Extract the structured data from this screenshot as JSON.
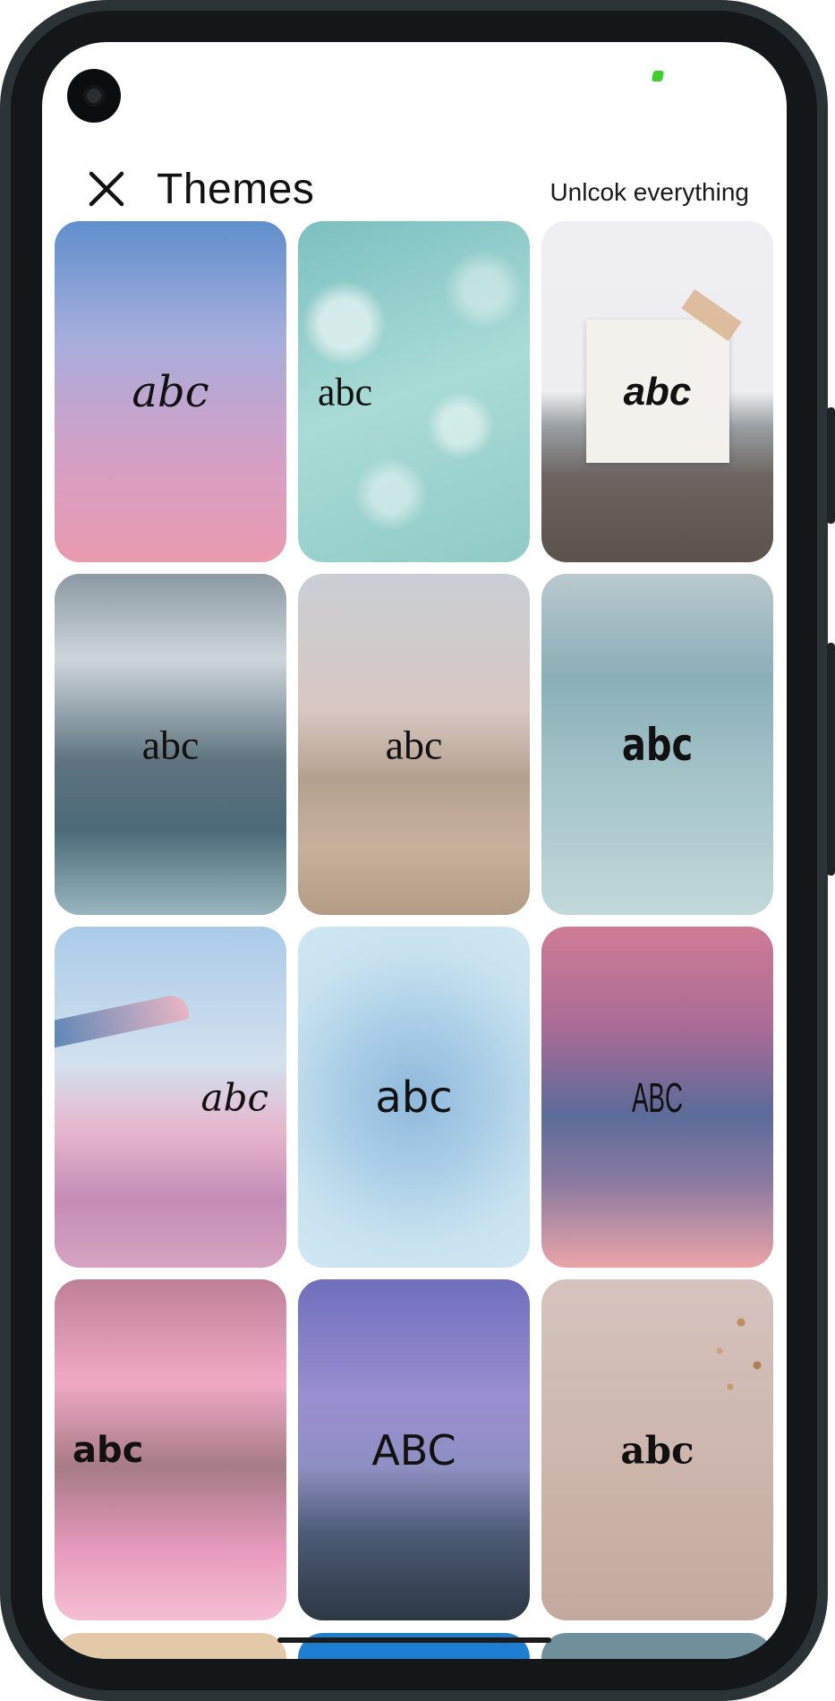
{
  "header": {
    "title": "Themes",
    "unlock_label": "Unlcok everything"
  },
  "themes": [
    {
      "sample": "abc",
      "style": "script",
      "background": "blue-pink gradient"
    },
    {
      "sample": "abc",
      "style": "serif-light",
      "background": "water"
    },
    {
      "sample": "abc",
      "style": "bold-italic",
      "background": "beach photo frame"
    },
    {
      "sample": "abc",
      "style": "mono-serif",
      "background": "mountain bridge"
    },
    {
      "sample": "abc",
      "style": "serif",
      "background": "coastline"
    },
    {
      "sample": "abc",
      "style": "heavy",
      "background": "sky with birds"
    },
    {
      "sample": "abc",
      "style": "script",
      "background": "airplane wing"
    },
    {
      "sample": "abc",
      "style": "sans",
      "background": "blue radial gradient"
    },
    {
      "sample": "ABC",
      "style": "condensed",
      "background": "pink clouds"
    },
    {
      "sample": "abc",
      "style": "heavy",
      "background": "pink clouds"
    },
    {
      "sample": "ABC",
      "style": "sans-caps",
      "background": "pier at dusk"
    },
    {
      "sample": "abc",
      "style": "bold-serif",
      "background": "dried flowers"
    }
  ],
  "colors": {
    "title_text": "#111111",
    "screen_background": "#ffffff",
    "frame": "#131719"
  },
  "icons": {
    "close": "close-icon"
  }
}
